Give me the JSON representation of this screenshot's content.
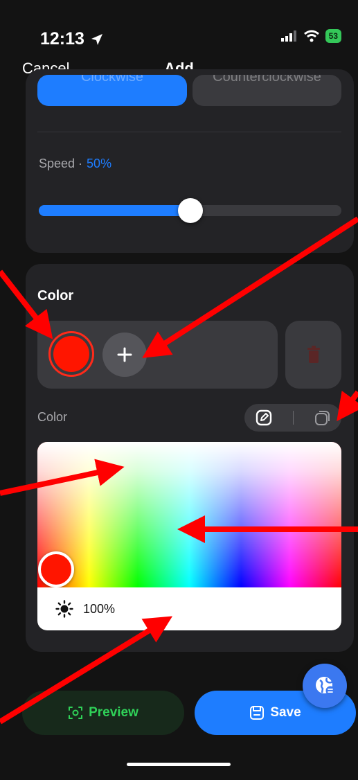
{
  "status_bar": {
    "time": "12:13",
    "battery": "53"
  },
  "nav": {
    "cancel_label": "Cancel",
    "title": "Add"
  },
  "direction": {
    "options": [
      "Clockwise",
      "Counterclockwise"
    ],
    "selected": "Clockwise"
  },
  "speed": {
    "label": "Speed ·",
    "value_text": "50%",
    "value": 0.5
  },
  "color_section": {
    "heading": "Color",
    "swatches": [
      {
        "color": "#ff1500",
        "selected": true
      }
    ],
    "add_icon": "plus-icon",
    "delete_icon": "trash-icon",
    "picker_label": "Color",
    "modes": [
      "pencil-edit-icon",
      "copy-icon"
    ],
    "selected_color": "#ff1500",
    "brightness_icon": "sun-icon",
    "brightness_text": "100%"
  },
  "actions": {
    "preview_label": "Preview",
    "save_label": "Save",
    "floating_icon": "globe-swap-icon"
  },
  "colors": {
    "accent": "#1e7dff",
    "preview_green": "#2fd158",
    "annotation_arrow": "#ff0000"
  }
}
